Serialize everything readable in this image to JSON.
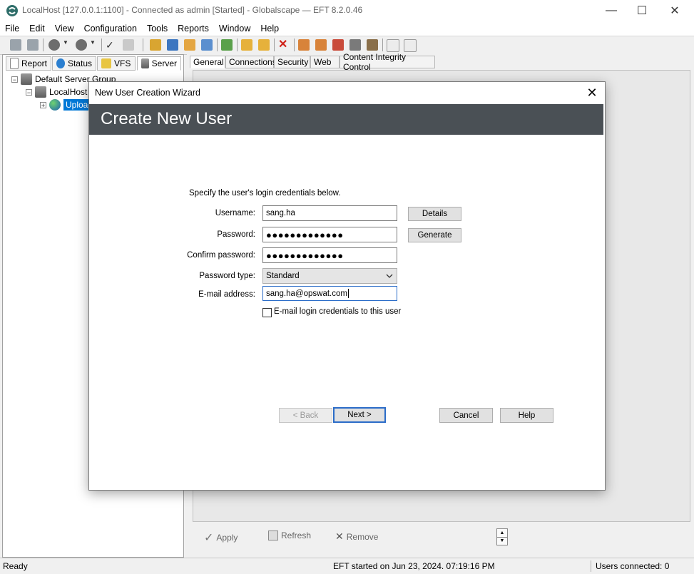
{
  "window": {
    "title": "LocalHost [127.0.0.1:1100] - Connected as admin [Started] - Globalscape — EFT 8.2.0.46",
    "minimize": "—",
    "maximize": "☐",
    "close": "✕"
  },
  "menu": [
    "File",
    "Edit",
    "View",
    "Configuration",
    "Tools",
    "Reports",
    "Window",
    "Help"
  ],
  "left_tabs": [
    {
      "label": "Report",
      "icon": "report-icon"
    },
    {
      "label": "Status",
      "icon": "globe-icon"
    },
    {
      "label": "VFS",
      "icon": "folder-icon"
    },
    {
      "label": "Server",
      "icon": "server-icon"
    }
  ],
  "tree": {
    "group": "Default Server Group",
    "server": "LocalHost",
    "site": "Uploads"
  },
  "right_tabs": [
    "General",
    "Connections",
    "Security",
    "Web",
    "Content Integrity Control"
  ],
  "actions": {
    "apply": "Apply",
    "refresh": "Refresh",
    "remove": "Remove"
  },
  "dialog": {
    "title": "New User Creation Wizard",
    "close": "✕",
    "heading": "Create New User",
    "instructions": "Specify the user's login credentials below.",
    "labels": {
      "username": "Username:",
      "password": "Password:",
      "confirm": "Confirm password:",
      "password_type": "Password type:",
      "email": "E-mail address:"
    },
    "values": {
      "username": "sang.ha",
      "password": "●●●●●●●●●●●●●",
      "confirm": "●●●●●●●●●●●●●",
      "password_type": "Standard",
      "email": "sang.ha@opswat.com"
    },
    "email_checkbox_label": "E-mail login credentials to this user",
    "email_checkbox_checked": false,
    "buttons": {
      "details": "Details",
      "generate": "Generate",
      "back": "< Back",
      "next": "Next >",
      "cancel": "Cancel",
      "help": "Help"
    }
  },
  "status": {
    "ready": "Ready",
    "started": "EFT started on Jun 23, 2024. 07:19:16 PM",
    "users": "Users connected: 0"
  },
  "colors": {
    "dialog_header_bg": "#4a5055",
    "selection": "#0078d7",
    "default_button_border": "#2a6cc8"
  }
}
